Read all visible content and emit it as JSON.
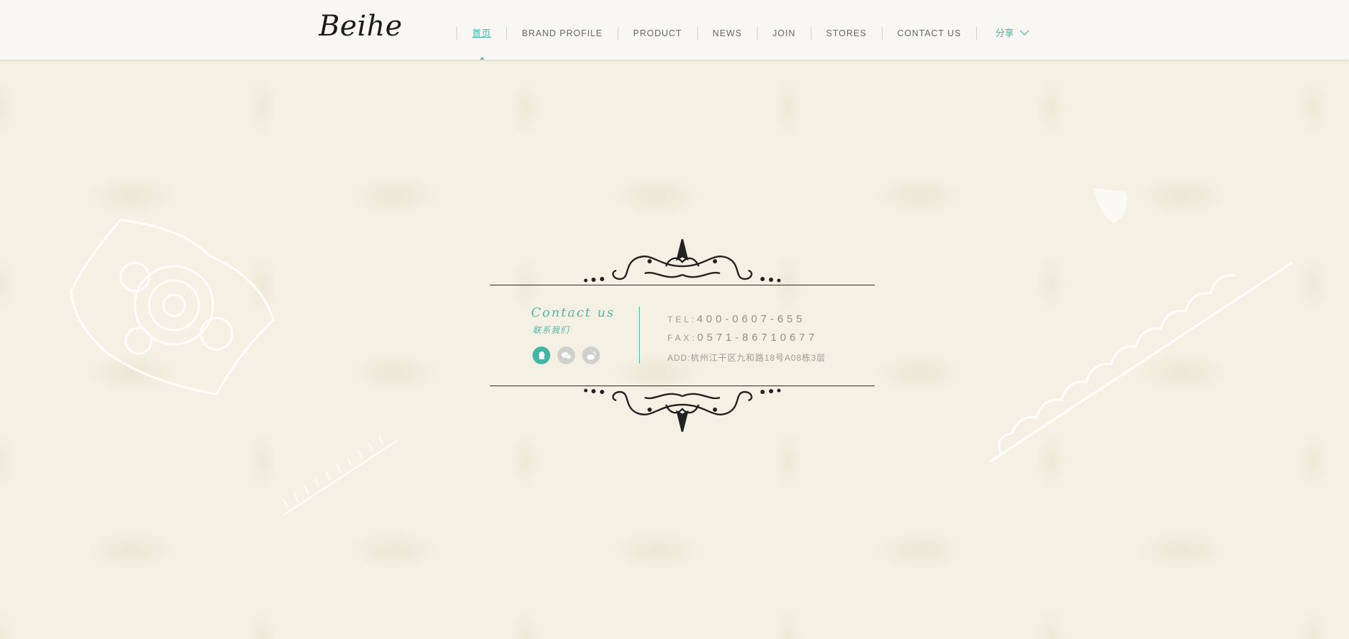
{
  "header": {
    "logo": "Beihe",
    "nav": [
      {
        "label": "首页",
        "active": true
      },
      {
        "label": "BRAND PROFILE",
        "active": false
      },
      {
        "label": "PRODUCT",
        "active": false
      },
      {
        "label": "NEWS",
        "active": false
      },
      {
        "label": "JOIN",
        "active": false
      },
      {
        "label": "STORES",
        "active": false
      },
      {
        "label": "CONTACT US",
        "active": false
      }
    ],
    "share_label": "分享",
    "share_icon": "chevron-down-icon"
  },
  "contact": {
    "title": "Contact us",
    "subtitle": "联系我们",
    "social_icons": [
      "qq-icon",
      "wechat-icon",
      "weibo-icon"
    ],
    "tel_label": "TEL:",
    "tel_value": "400-0607-655",
    "fax_label": "FAX:",
    "fax_value": "0571-86710677",
    "address": "ADD:杭州江干区九和路18号A08栋3层"
  },
  "colors": {
    "accent": "#45b5a6",
    "background": "#f4f0e3",
    "header_bg": "#f8f7f4"
  }
}
